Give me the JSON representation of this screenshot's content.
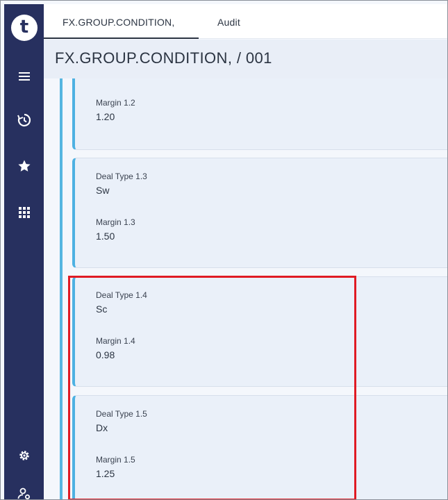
{
  "sidebar": {
    "logo_letter": "t",
    "icons": [
      "menu-icon",
      "history-icon",
      "star-icon",
      "grid-icon",
      "settings-icon",
      "user-settings-icon"
    ]
  },
  "tabs": [
    {
      "label": "FX.GROUP.CONDITION,",
      "active": true
    },
    {
      "label": "Audit",
      "active": false
    }
  ],
  "page_title": "FX.GROUP.CONDITION, / 001",
  "cards": [
    {
      "margin_label": "Margin 1.2",
      "margin_value": "1.20"
    },
    {
      "deal_label": "Deal Type 1.3",
      "deal_value": "Sw",
      "margin_label": "Margin 1.3",
      "margin_value": "1.50"
    },
    {
      "deal_label": "Deal Type 1.4",
      "deal_value": "Sc",
      "margin_label": "Margin 1.4",
      "margin_value": "0.98"
    },
    {
      "deal_label": "Deal Type 1.5",
      "deal_value": "Dx",
      "margin_label": "Margin 1.5",
      "margin_value": "1.25"
    }
  ],
  "colors": {
    "sidebar": "#27305f",
    "accent_line": "#4db1e2",
    "highlight": "#e01b24"
  }
}
